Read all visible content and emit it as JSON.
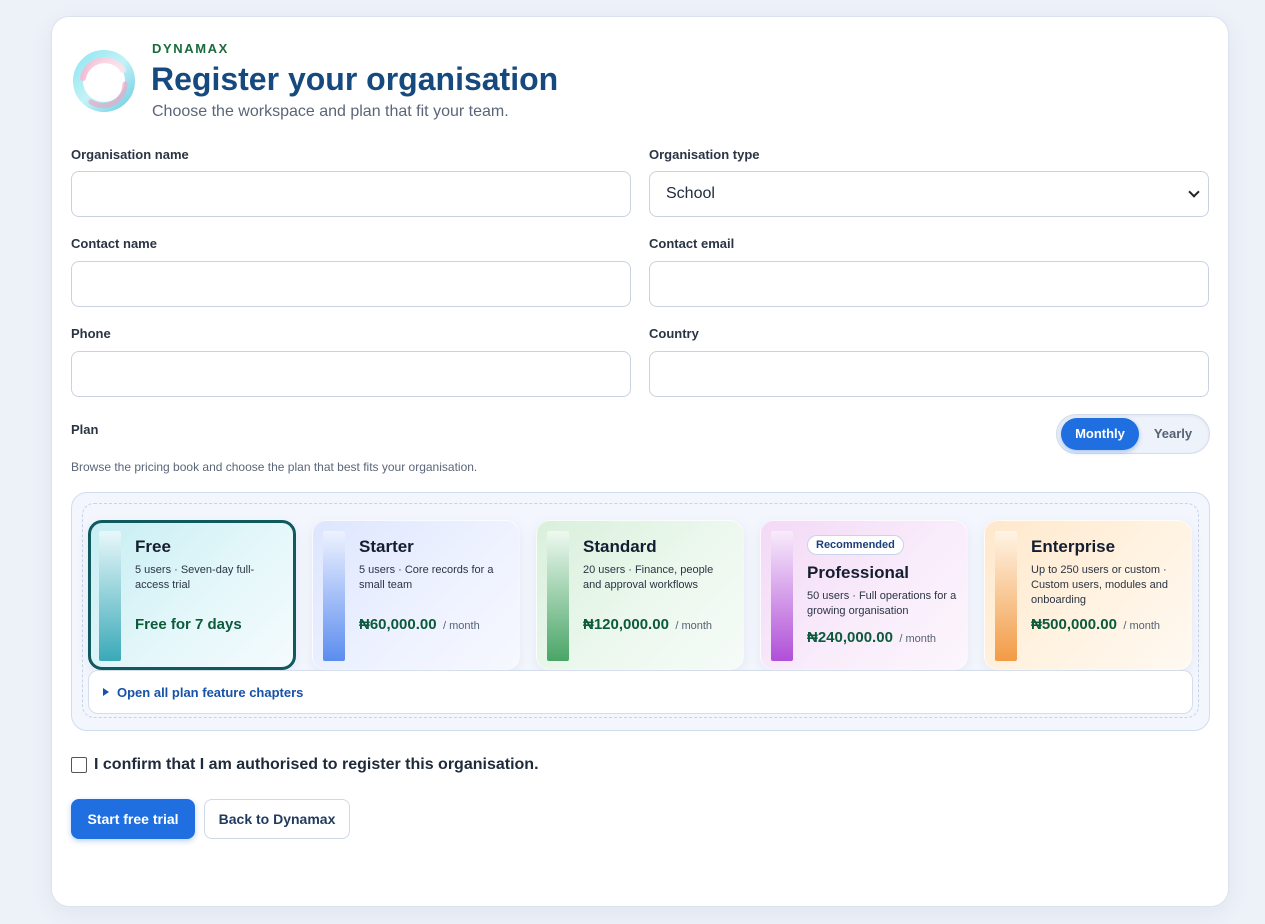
{
  "header": {
    "brand": "DYNAMAX",
    "title": "Register your organisation",
    "subtitle": "Choose the workspace and plan that fit your team.",
    "logo_icon": "swirl-logo-icon"
  },
  "form": {
    "organisation_name": {
      "label": "Organisation name",
      "value": ""
    },
    "organisation_type": {
      "label": "Organisation type",
      "value": "School"
    },
    "contact_name": {
      "label": "Contact name",
      "value": ""
    },
    "contact_email": {
      "label": "Contact email",
      "value": ""
    },
    "phone": {
      "label": "Phone",
      "value": ""
    },
    "country": {
      "label": "Country",
      "value": ""
    }
  },
  "plan_section": {
    "label": "Plan",
    "description": "Browse the pricing book and choose the plan that best fits your organisation.",
    "billing": {
      "monthly": "Monthly",
      "yearly": "Yearly",
      "selected": "Monthly"
    },
    "chapters_label": "Open all plan feature chapters",
    "plans": [
      {
        "name": "Free",
        "meta": "5 users · Seven-day full-access trial",
        "price": "Free for 7 days",
        "unit": "",
        "badge": "",
        "selected": true
      },
      {
        "name": "Starter",
        "meta": "5 users · Core records for a small team",
        "price": "₦60,000.00",
        "unit": "/ month",
        "badge": "",
        "selected": false
      },
      {
        "name": "Standard",
        "meta": "20 users · Finance, people and approval workflows",
        "price": "₦120,000.00",
        "unit": "/ month",
        "badge": "",
        "selected": false
      },
      {
        "name": "Professional",
        "meta": "50 users · Full operations for a growing organisation",
        "price": "₦240,000.00",
        "unit": "/ month",
        "badge": "Recommended",
        "selected": false
      },
      {
        "name": "Enterprise",
        "meta": "Up to 250 users or custom · Custom users, modules and onboarding",
        "price": "₦500,000.00",
        "unit": "/ month",
        "badge": "",
        "selected": false
      }
    ]
  },
  "confirm": {
    "label": "I confirm that I am authorised to register this organisation.",
    "checked": false
  },
  "actions": {
    "primary": "Start free trial",
    "secondary": "Back to Dynamax"
  },
  "colors": {
    "accent": "#1f6fe0",
    "title": "#164a7e",
    "brand": "#1a6b3c",
    "price": "#0c5a3c"
  }
}
